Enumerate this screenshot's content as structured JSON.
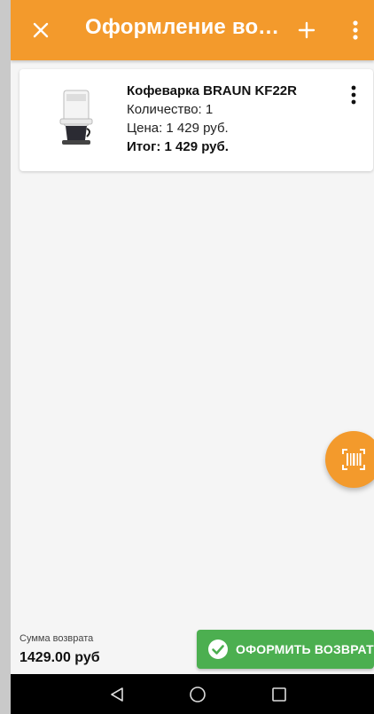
{
  "appbar": {
    "title": "Оформление возврата",
    "close_icon": "close-icon",
    "add_icon": "plus-icon",
    "more_icon": "more-vert-icon",
    "color": "#f39a2c"
  },
  "item": {
    "name": "Кофеварка BRAUN KF22R",
    "quantity": "Количество: 1",
    "price": "Цена: 1 429 руб.",
    "total": "Итог: 1 429 руб.",
    "image_icon": "coffee-maker-image",
    "menu_icon": "more-vert-icon"
  },
  "fab": {
    "icon": "barcode-scanner-icon",
    "color": "#f39a2c"
  },
  "summary": {
    "label": "Сумма возврата",
    "value": "1429.00 руб"
  },
  "submit": {
    "label": "ОФОРМИТЬ ВОЗВРАТ",
    "icon": "check-circle-icon",
    "color": "#4caf50"
  },
  "navbar": {
    "back_icon": "back-triangle-icon",
    "home_icon": "home-circle-icon",
    "recents_icon": "recents-square-icon"
  }
}
